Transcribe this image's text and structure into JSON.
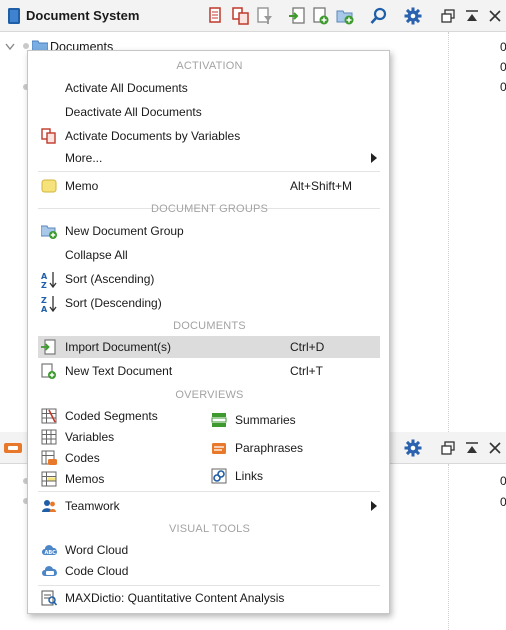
{
  "top_window": {
    "title": "Document System",
    "tree_root_label": "Documents",
    "right_values": [
      "0",
      "0",
      "0"
    ]
  },
  "bottom_window": {
    "right_values": [
      "0",
      "0"
    ]
  },
  "context_menu": {
    "sections": {
      "activation": "ACTIVATION",
      "document_groups": "DOCUMENT GROUPS",
      "documents": "DOCUMENTS",
      "overviews": "OVERVIEWS",
      "visual_tools": "VISUAL TOOLS"
    },
    "items": {
      "activate_all": "Activate All Documents",
      "deactivate_all": "Deactivate All Documents",
      "activate_by_vars": "Activate Documents by Variables",
      "more": "More...",
      "memo": "Memo",
      "memo_shortcut": "Alt+Shift+M",
      "new_group": "New Document Group",
      "collapse_all": "Collapse All",
      "sort_asc": "Sort (Ascending)",
      "sort_desc": "Sort (Descending)",
      "import": "Import Document(s)",
      "import_shortcut": "Ctrl+D",
      "new_text": "New Text Document",
      "new_text_shortcut": "Ctrl+T",
      "teamwork": "Teamwork",
      "word_cloud": "Word Cloud",
      "code_cloud": "Code Cloud",
      "maxdictio": "MAXDictio: Quantitative Content Analysis"
    },
    "overviews": {
      "coded_segments": "Coded Segments",
      "variables": "Variables",
      "codes": "Codes",
      "memos": "Memos",
      "summaries": "Summaries",
      "paraphrases": "Paraphrases",
      "links": "Links"
    }
  },
  "colors": {
    "accent_blue": "#1f5fa8",
    "gear_blue": "#2a62b0",
    "green": "#3e9a2f",
    "memo_yellow": "#f6e27a",
    "highlight": "#dcdcdc"
  }
}
